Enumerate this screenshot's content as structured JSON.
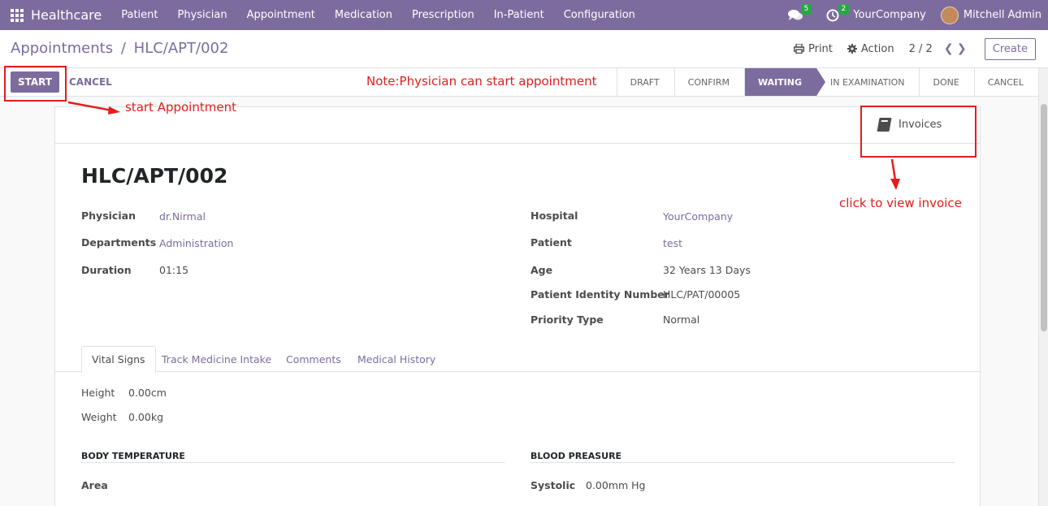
{
  "navbar": {
    "brand": "Healthcare",
    "menu": [
      "Patient",
      "Physician",
      "Appointment",
      "Medication",
      "Prescription",
      "In-Patient",
      "Configuration"
    ],
    "messages_count": "5",
    "activities_count": "2",
    "company": "YourCompany",
    "user": "Mitchell Admin"
  },
  "control_panel": {
    "breadcrumb_parent": "Appointments",
    "breadcrumb_sep": "/",
    "breadcrumb_current": "HLC/APT/002",
    "print_label": "Print",
    "action_label": "Action",
    "pager": "2 / 2",
    "create_label": "Create"
  },
  "statusbar": {
    "start_label": "START",
    "cancel_label": "CANCEL",
    "stages": [
      "DRAFT",
      "CONFIRM",
      "WAITING",
      "IN EXAMINATION",
      "DONE",
      "CANCEL"
    ],
    "active_stage": "WAITING"
  },
  "form": {
    "invoices_label": "Invoices",
    "title": "HLC/APT/002",
    "left_fields": [
      {
        "label": "Physician",
        "value": "dr.Nirmal"
      },
      {
        "label": "Departments",
        "value": "Administration"
      },
      {
        "label": "Duration",
        "value": "01:15"
      }
    ],
    "right_fields": [
      {
        "label": "Hospital",
        "value": "YourCompany"
      },
      {
        "label": "Patient",
        "value": "test"
      },
      {
        "label": "Age",
        "value": "32 Years 13 Days"
      },
      {
        "label": "Patient Identity Number",
        "value": "HLC/PAT/00005"
      },
      {
        "label": "Priority Type",
        "value": "Normal"
      }
    ],
    "tabs": [
      "Vital Signs",
      "Track Medicine Intake",
      "Comments",
      "Medical History"
    ],
    "active_tab": "Vital Signs",
    "vitals": [
      {
        "label": "Height",
        "value": "0.00cm"
      },
      {
        "label": "Weight",
        "value": "0.00kg"
      }
    ],
    "body_temperature_title": "BODY TEMPERATURE",
    "area_label": "Area",
    "blood_pressure_title": "BLOOD PREASURE",
    "systolic_label": "Systolic",
    "systolic_value": "0.00mm Hg"
  },
  "annotations": {
    "note": "Note:Physician can start appointment",
    "start_hint": "start Appointment",
    "invoice_hint": "click to view invoice",
    "color": "#e51c1c"
  },
  "theme": {
    "primary": "#7c6c9e",
    "badge": "#28a745"
  }
}
